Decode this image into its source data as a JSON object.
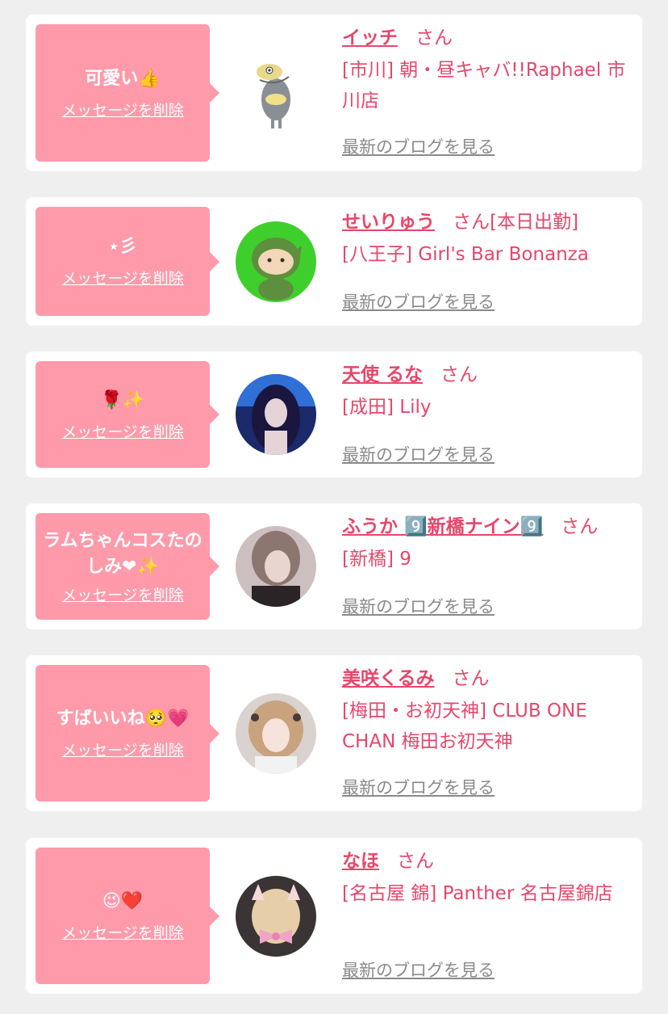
{
  "rows": [
    {
      "message": "可愛い👍",
      "delete_label": "メッセージを削除",
      "name": "イッチ",
      "honorific": "さん",
      "status": "",
      "shop": "[市川] 朝・昼キャバ!!Raphael 市川店",
      "blog_link": "最新のブログを見る",
      "avatar_icon": "fish-character-icon"
    },
    {
      "message": "⋆彡",
      "delete_label": "メッセージを削除",
      "name": "せいりゅう",
      "honorific": "さん",
      "status": "[本日出勤]",
      "shop": "[八王子] Girl's Bar Bonanza",
      "blog_link": "最新のブログを見る",
      "avatar_icon": "green-character-icon"
    },
    {
      "message": "🌹✨",
      "delete_label": "メッセージを削除",
      "name": "天使 るな",
      "honorific": "さん",
      "status": "",
      "shop": "[成田] Lily",
      "blog_link": "最新のブログを見る",
      "avatar_icon": "profile-photo"
    },
    {
      "message": "ラムちゃんコスたのしみ❤✨",
      "delete_label": "メッセージを削除",
      "name": "ふうか 9️⃣新橋ナイン9️⃣",
      "honorific": "さん",
      "status": "",
      "shop": "[新橋] 9",
      "blog_link": "最新のブログを見る",
      "avatar_icon": "profile-photo"
    },
    {
      "message": "すばいいね🥺💗",
      "delete_label": "メッセージを削除",
      "name": "美咲くるみ",
      "honorific": "さん",
      "status": "",
      "shop": "[梅田・お初天神] CLUB ONE CHAN 梅田お初天神",
      "blog_link": "最新のブログを見る",
      "avatar_icon": "profile-photo"
    },
    {
      "message": "😉❤️",
      "delete_label": "メッセージを削除",
      "name": "なほ",
      "honorific": "さん",
      "status": "",
      "shop": "[名古屋 錦] Panther 名古屋錦店",
      "blog_link": "最新のブログを見る",
      "avatar_icon": "profile-photo"
    }
  ]
}
